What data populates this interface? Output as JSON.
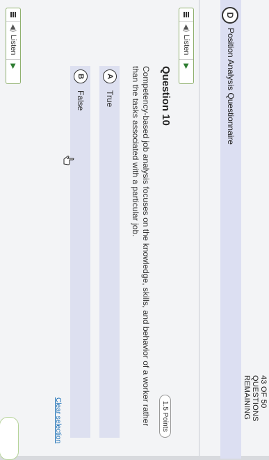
{
  "header": {
    "questions_remaining": "43 OF 50 QUESTIONS REMAINING"
  },
  "previous_answer": {
    "letter": "D",
    "text": "Position Analysis Questionnaire"
  },
  "listen": {
    "label": "Listen"
  },
  "question": {
    "number_label": "Question 10",
    "points": "1.5 Points",
    "text": "Competency-based job analysis focuses on the knowledge, skills, and behavior of a worker rather than the tasks associated with a particular job.",
    "options": [
      {
        "letter": "A",
        "text": "True"
      },
      {
        "letter": "B",
        "text": "False"
      }
    ],
    "clear_selection": "Clear selection"
  },
  "colors": {
    "option_bg": "#dde0f0",
    "listen_border": "#8fb06e",
    "link": "#1a6fb5"
  },
  "icons": [
    "menu-icon",
    "speaker-icon",
    "play-icon",
    "hand-pointer-icon"
  ]
}
